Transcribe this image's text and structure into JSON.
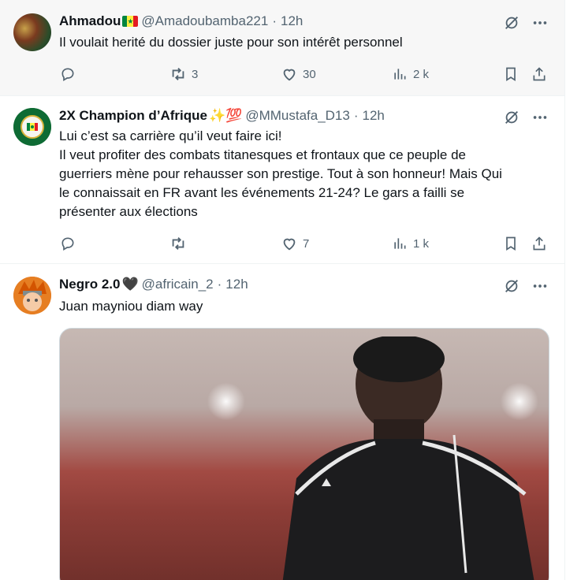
{
  "tweets": [
    {
      "name": "Ahmadou",
      "handle": "@Amadoubamba221",
      "separator": "·",
      "time": "12h",
      "text": [
        "Il voulait herité du dossier juste pour son intérêt personnel"
      ],
      "stats": {
        "retweets": "3",
        "likes": "30",
        "views": "2 k"
      }
    },
    {
      "name": "2X Champion d’Afrique",
      "name_emoji": "✨💯",
      "handle": "@MMustafa_D13",
      "separator": "·",
      "time": "12h",
      "text": [
        "Lui c’est sa carrière qu’il veut faire ici!",
        "Il veut profiter des combats titanesques et frontaux que ce peuple de",
        "guerriers mène pour rehausser son prestige. Tout à son honneur! Mais Qui",
        "le connaissait en FR avant les événements 21-24? Le gars a failli se",
        "présenter aux élections"
      ],
      "stats": {
        "retweets": "",
        "likes": "7",
        "views": "1 k"
      }
    },
    {
      "name": "Negro 2.0",
      "name_emoji": "🖤",
      "handle": "@africain_2",
      "separator": "·",
      "time": "12h",
      "text": [
        "Juan mayniou diam way"
      ]
    }
  ],
  "colors": {
    "flag_green": "#00853f",
    "flag_yellow": "#fdef42",
    "flag_red": "#e31b23",
    "text": "#0f1419",
    "muted": "#536471"
  },
  "icons": [
    "grok-icon",
    "more-icon",
    "reply-icon",
    "retweet-icon",
    "like-icon",
    "views-icon",
    "bookmark-icon",
    "share-icon"
  ]
}
